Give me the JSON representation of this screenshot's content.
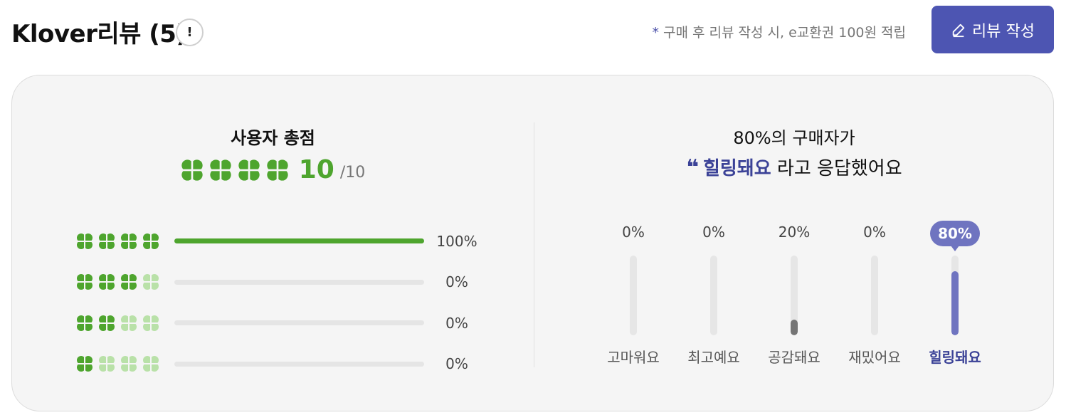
{
  "header": {
    "title": "Klover리뷰 (5)",
    "info_icon": "!",
    "notice_mark": "*",
    "notice_text": "구매 후 리뷰 작성 시, e교환권 100원 적립",
    "write_button_label": "리뷰 작성",
    "write_button_icon": "pencil-icon"
  },
  "score": {
    "title": "사용자 총점",
    "value": "10",
    "max": "/10",
    "clovers_filled": 4
  },
  "distribution": [
    {
      "clovers_filled": 4,
      "percent_label": "100%",
      "fraction": 1.0
    },
    {
      "clovers_filled": 3,
      "percent_label": "0%",
      "fraction": 0
    },
    {
      "clovers_filled": 2,
      "percent_label": "0%",
      "fraction": 0
    },
    {
      "clovers_filled": 1,
      "percent_label": "0%",
      "fraction": 0
    }
  ],
  "emotion": {
    "title": "80%의 구매자가",
    "quote_mark": "❝",
    "highlight": "힐링돼요",
    "suffix": " 라고 응답했어요",
    "items": [
      {
        "label": "고마워요",
        "percent_label": "0%",
        "fraction": 0,
        "active": false
      },
      {
        "label": "최고예요",
        "percent_label": "0%",
        "fraction": 0,
        "active": false
      },
      {
        "label": "공감돼요",
        "percent_label": "20%",
        "fraction": 0.2,
        "active": false
      },
      {
        "label": "재밌어요",
        "percent_label": "0%",
        "fraction": 0,
        "active": false
      },
      {
        "label": "힐링돼요",
        "percent_label": "80%",
        "fraction": 0.8,
        "active": true
      }
    ]
  },
  "colors": {
    "brand": "#4d55b2",
    "accent_text": "#3b4297",
    "clover_green": "#4ea52e",
    "clover_light": "#b9e1a8",
    "active_bar": "#6f74c0",
    "inactive_bar_fill": "#757575"
  }
}
